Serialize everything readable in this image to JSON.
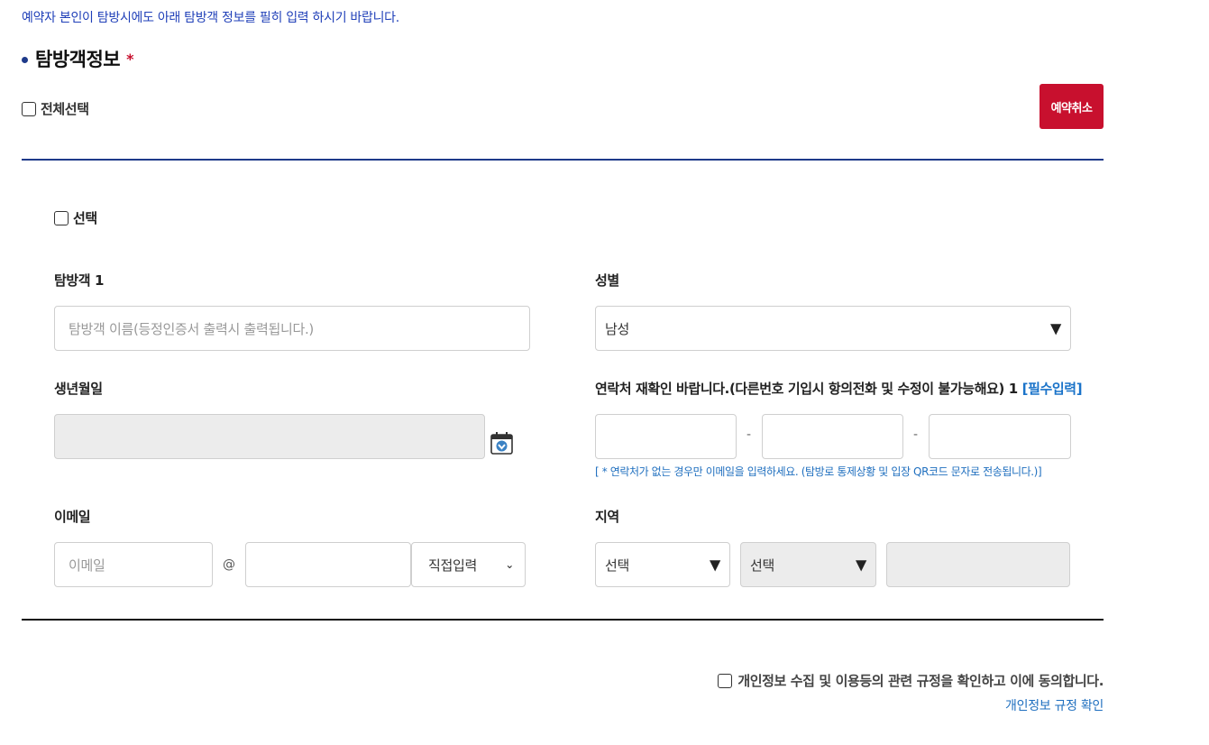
{
  "notice": "예약자 본인이 탐방시에도 아래 탐방객 정보를 필히 입력 하시기 바랍니다.",
  "section": {
    "title": "탐방객정보",
    "required_mark": "*"
  },
  "select_all_label": "전체선택",
  "cancel_button": "예약취소",
  "visitor": {
    "select_label": "선택",
    "name_label": "탐방객 1",
    "name_placeholder": "탐방객 이름(등정인증서 출력시 출력됩니다.)",
    "gender_label": "성별",
    "gender_value": "남성",
    "birth_label": "생년월일",
    "birth_value": "",
    "phone_label": "연락처 재확인 바랍니다.(다른번호 기입시 항의전화 및 수정이 불가능해요) 1",
    "phone_required": "[필수입력]",
    "phone_sep": "-",
    "phone_parts": [
      "",
      "",
      ""
    ],
    "phone_note": "[ * 연락처가 없는 경우만 이메일을 입력하세요. (탐방로 통제상황 및 입장 QR코드 문자로 전송됩니다.)]",
    "email_label": "이메일",
    "email_placeholder": "이메일",
    "email_at": "@",
    "email_domain": "",
    "email_domain_select": "직접입력",
    "region_label": "지역",
    "region_select_1": "선택",
    "region_select_2": "선택",
    "region_text": ""
  },
  "agreement": {
    "label": "개인정보 수집 및 이용등의 관련 규정을 확인하고 이에 동의합니다.",
    "link": "개인정보 규정 확인"
  },
  "icons": {
    "triangle": "▼",
    "chevron": "⌄"
  },
  "colors": {
    "accent_blue": "#1e3a8a",
    "cancel_red": "#c8102e",
    "link_blue": "#1f6fbf",
    "notice_blue": "#1f3fb8"
  }
}
